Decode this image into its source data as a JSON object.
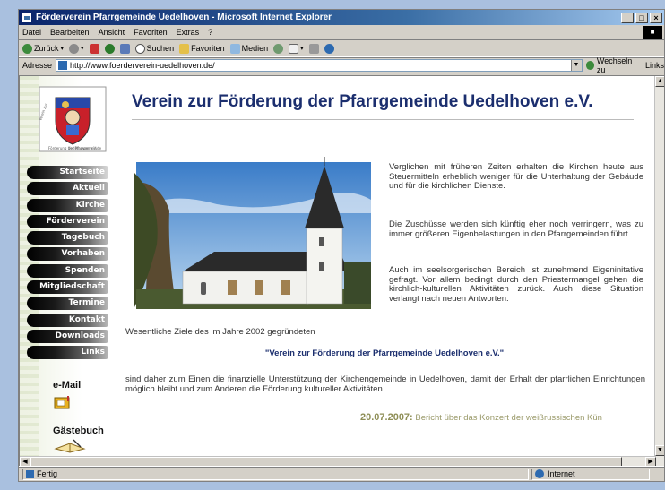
{
  "window": {
    "title": "Förderverein Pfarrgemeinde Uedelhoven - Microsoft Internet Explorer",
    "controls": [
      "_",
      "□",
      "×"
    ]
  },
  "menubar": {
    "items": [
      "Datei",
      "Bearbeiten",
      "Ansicht",
      "Favoriten",
      "Extras",
      "?"
    ]
  },
  "toolbar": {
    "back_label": "Zurück",
    "search_label": "Suchen",
    "favorites_label": "Favoriten",
    "media_label": "Medien"
  },
  "addressbar": {
    "label": "Adresse",
    "url": "http://www.foerderverein-uedelhoven.de/",
    "goto_label": "Wechseln zu",
    "links_label": "Links"
  },
  "page": {
    "heading": "Verein zur Förderung der Pfarrgemeinde Uedelhoven e.V.",
    "crest_text": "Verein zur Förderung der Pfarrgemeinde Uedelhoven e.V.",
    "nav": [
      "Startseite",
      "Aktuell",
      "Kirche",
      "Förderverein",
      "Tagebuch",
      "Vorhaben",
      "Spenden",
      "Mitgliedschaft",
      "Termine",
      "Kontakt",
      "Downloads",
      "Links"
    ],
    "email_label": "e-Mail",
    "guestbook_label": "Gästebuch",
    "paragraphs": [
      "Verglichen mit früheren Zeiten erhalten die Kirchen heute aus Steuermitteln erheblich weniger für die Unterhaltung der Gebäude und für die kirchlichen Dienste.",
      "Die Zuschüsse werden sich künftig eher noch verringern, was zu immer größeren Eigenbelastungen in den Pfarrgemeinden führt.",
      "Auch im seelsorgerischen Bereich ist zunehmend Eigeninitative gefragt. Vor allem bedingt durch den Priestermangel gehen die kirchlich-kulturellen Aktivitäten zurück. Auch diese Situation verlangt nach neuen Antworten."
    ],
    "goals_text": "Wesentliche Ziele des im Jahre 2002 gegründeten",
    "quote": "\"Verein zur Förderung der Pfarrgemeinde Uedelhoven e.V.\"",
    "bottom_text": "sind daher zum Einen die finanzielle Unterstützung der Kirchengemeinde in Uedelhoven, damit der Erhalt der pfarrlichen Einrichtungen möglich bleibt und zum Anderen die Förderung kultureller Aktivitäten.",
    "news_date": "20.07.2007:",
    "news_text": " Bericht über das Konzert der weißrussischen Kün"
  },
  "statusbar": {
    "status": "Fertig",
    "zone": "Internet"
  },
  "colors": {
    "heading": "#1b2e6e",
    "titlebar": "#0a246a",
    "news_date": "#8e8e56"
  }
}
